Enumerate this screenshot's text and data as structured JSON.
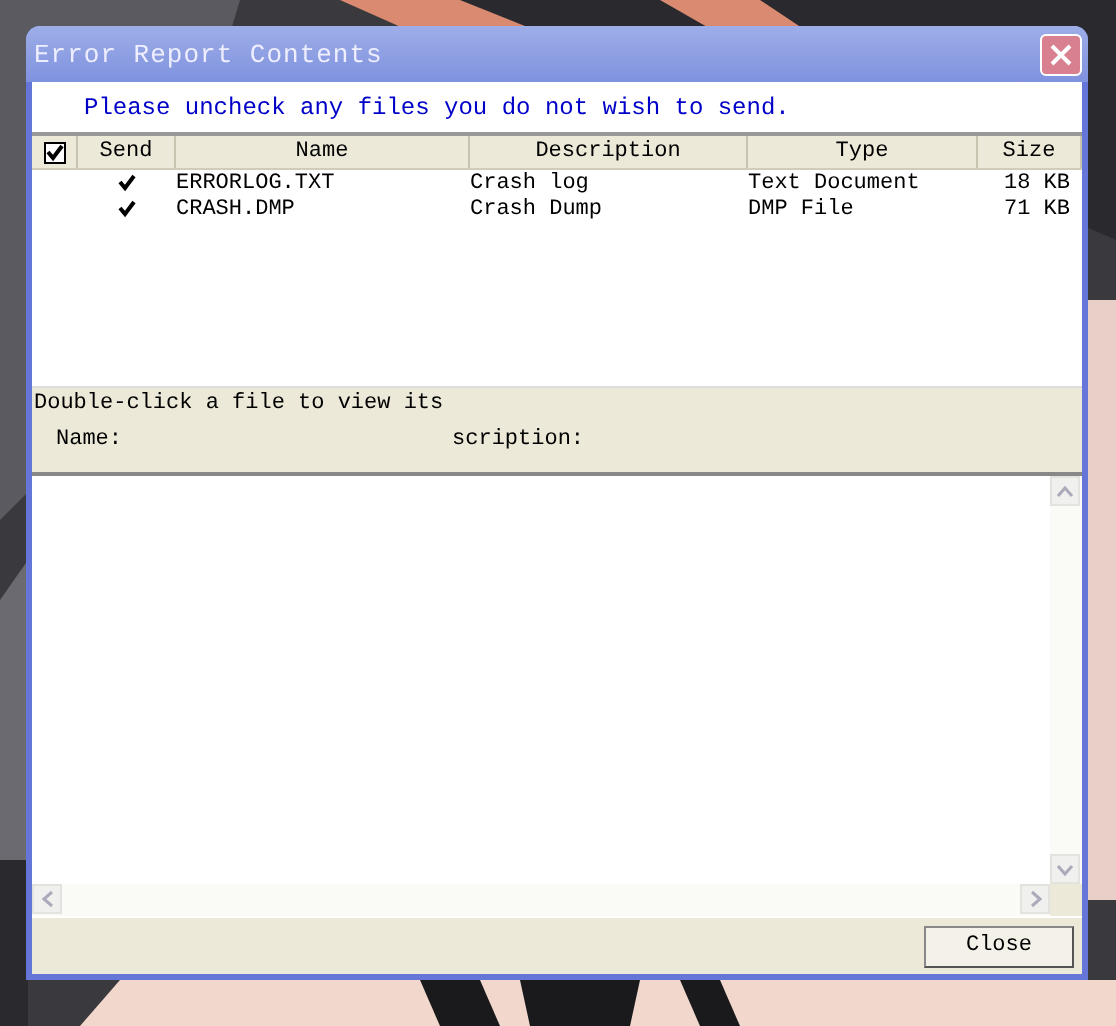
{
  "window": {
    "title": "Error Report Contents"
  },
  "instruction": "Please uncheck any files you do not wish to send.",
  "file_list": {
    "all_checked": true,
    "columns": [
      "Send",
      "Name",
      "Description",
      "Type",
      "Size"
    ],
    "rows": [
      {
        "send": true,
        "name": "ERRORLOG.TXT",
        "description": "Crash log",
        "type": "Text Document",
        "size": "18 KB"
      },
      {
        "send": true,
        "name": "CRASH.DMP",
        "description": "Crash Dump",
        "type": "DMP File",
        "size": "71 KB"
      }
    ]
  },
  "details": {
    "hint": "Double-click a file to view its",
    "name_label": "Name:",
    "description_label": "scription:"
  },
  "buttons": [
    "Close"
  ]
}
